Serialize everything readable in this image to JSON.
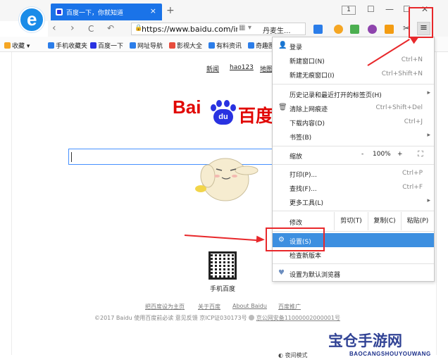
{
  "tab": {
    "title": "百度一下，你就知道",
    "close": "×",
    "new_tab": "+"
  },
  "window": {
    "tab_count": "1",
    "minimize": "—",
    "maximize": "☐",
    "close": "✕",
    "skin": "☐"
  },
  "nav": {
    "back": "‹",
    "forward": "›",
    "reload": "C",
    "undo": "↶",
    "url": "https://www.baidu.com/index",
    "suggest": "丹麦生...",
    "menu_icon": "≡"
  },
  "bookmarks": [
    {
      "label": "收藏",
      "icon": "star-icon",
      "color": "#f5a623"
    },
    {
      "label": "手机收藏夹",
      "icon": "phone-icon",
      "color": "#2b7de9"
    },
    {
      "label": "百度一下",
      "icon": "baidu-icon",
      "color": "#2932e1"
    },
    {
      "label": "网址导航",
      "icon": "nav-icon",
      "color": "#2b7de9"
    },
    {
      "label": "影视大全",
      "icon": "video-icon",
      "color": "#e74c3c"
    },
    {
      "label": "有料资讯",
      "icon": "news-icon",
      "color": "#2b7de9"
    },
    {
      "label": "奇趣图",
      "icon": "image-icon",
      "color": "#2b7de9"
    }
  ],
  "baidu": {
    "top_links": [
      "新闻",
      "hao123",
      "地图"
    ],
    "logo_text": "Bai",
    "logo_paw": "du",
    "logo_cn": "百度",
    "qr_caption": "手机百度",
    "footer_links": [
      "把百度设为主页",
      "关于百度",
      "About Baidu",
      "百度推广"
    ],
    "copyright": "©2017 Baidu 使用百度前必读 意见反馈 京ICP证030173号",
    "police": "京公网安备11000002000001号",
    "night_mode": "夜间模式"
  },
  "menu": {
    "login": "登录",
    "new_window": {
      "label": "新建窗口(N)",
      "shortcut": "Ctrl+N"
    },
    "incognito": {
      "label": "新建无痕窗口(I)",
      "shortcut": "Ctrl+Shift+N"
    },
    "history": {
      "label": "历史记录和最近打开的标签页(H)"
    },
    "clear": {
      "label": "清除上网痕迹",
      "shortcut": "Ctrl+Shift+Del"
    },
    "downloads": {
      "label": "下载内容(D)",
      "shortcut": "Ctrl+J"
    },
    "bookmarks": {
      "label": "书签(B)"
    },
    "zoom": {
      "label": "缩放",
      "minus": "-",
      "value": "100%",
      "plus": "+",
      "fullscreen": "⛶"
    },
    "print": {
      "label": "打印(P)...",
      "shortcut": "Ctrl+P"
    },
    "find": {
      "label": "查找(F)...",
      "shortcut": "Ctrl+F"
    },
    "more_tools": {
      "label": "更多工具(L)"
    },
    "edit": {
      "label": "修改",
      "cut": "剪切(T)",
      "copy": "复制(C)",
      "paste": "粘贴(P)"
    },
    "settings": {
      "label": "设置(S)"
    },
    "check_update": {
      "label": "检查新版本"
    },
    "default_browser": {
      "label": "设置为默认浏览器"
    }
  },
  "watermark": {
    "main": "宝仓手游网",
    "sub": "BAOCANGSHOUYOUWANG"
  },
  "colors": {
    "tab_blue": "#1a73e8",
    "baidu_red": "#e10602",
    "baidu_blue": "#2932e1",
    "menu_selected": "#3d8fe0",
    "annotation_red": "#e8282b"
  }
}
